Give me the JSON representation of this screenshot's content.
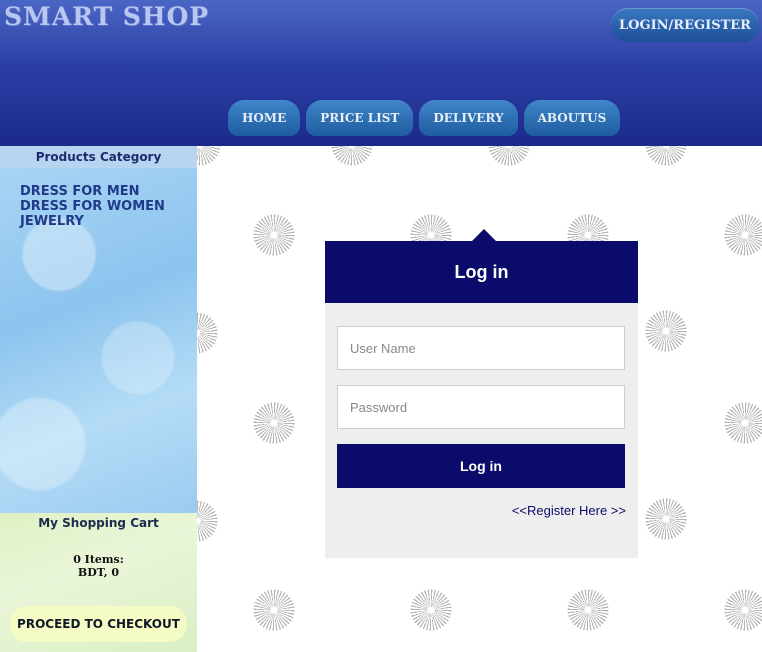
{
  "header": {
    "logo_text": "SMART SHOP",
    "login_label": "LOGIN/REGISTER",
    "nav": [
      "HOME",
      "PRICE LIST",
      "DELIVERY",
      "ABOUTUS"
    ]
  },
  "sidebar": {
    "category_title": "Products Category",
    "categories": [
      "DRESS FOR MEN",
      "DRESS FOR WOMEN",
      "JEWELRY"
    ],
    "cart_title": "My Shopping Cart",
    "cart_items": "0 Items:",
    "cart_total": "BDT, 0",
    "checkout_label": "PROCEED TO CHECKOUT"
  },
  "login": {
    "title": "Log in",
    "username_placeholder": "User Name",
    "password_placeholder": "Password",
    "submit_label": "Log in",
    "register_label": "<<Register Here >>"
  },
  "colors": {
    "header_blue": "#2c3fa6",
    "login_navy": "#0b0b6b",
    "sidebar_blue": "#a8d4f4",
    "cart_green": "#dff0c4"
  }
}
